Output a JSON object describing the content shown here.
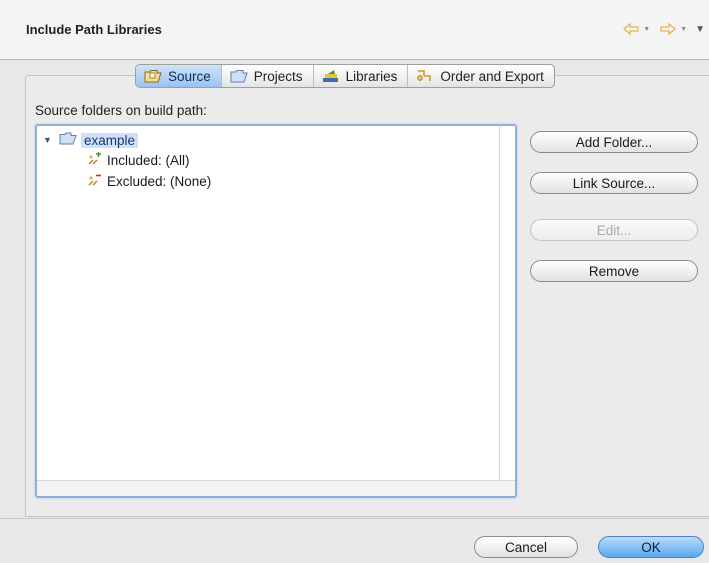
{
  "dialog": {
    "title": "Include Path Libraries"
  },
  "nav": {
    "back_icon": "back-arrow-icon",
    "forward_icon": "forward-arrow-icon",
    "menu_icon": "view-menu-icon",
    "arrow_color": "#e2b54a"
  },
  "tabs": [
    {
      "label": "Source",
      "icon": "source-folder-icon",
      "active": true
    },
    {
      "label": "Projects",
      "icon": "projects-folder-icon",
      "active": false
    },
    {
      "label": "Libraries",
      "icon": "libraries-icon",
      "active": false
    },
    {
      "label": "Order and Export",
      "icon": "order-export-icon",
      "active": false
    }
  ],
  "source": {
    "label": "Source folders on build path:",
    "tree": {
      "root": {
        "label": "example",
        "icon": "folder-icon",
        "expanded": true,
        "selected": true
      },
      "children": [
        {
          "label": "Included: (All)",
          "icon": "inclusion-filter-icon"
        },
        {
          "label": "Excluded: (None)",
          "icon": "exclusion-filter-icon"
        }
      ]
    }
  },
  "buttons": {
    "add_folder": "Add Folder...",
    "link_source": "Link Source...",
    "edit": "Edit...",
    "remove": "Remove"
  },
  "footer": {
    "cancel": "Cancel",
    "ok": "OK"
  },
  "colors": {
    "selection": "#cfe0f7",
    "accent": "#5aa7ef"
  }
}
